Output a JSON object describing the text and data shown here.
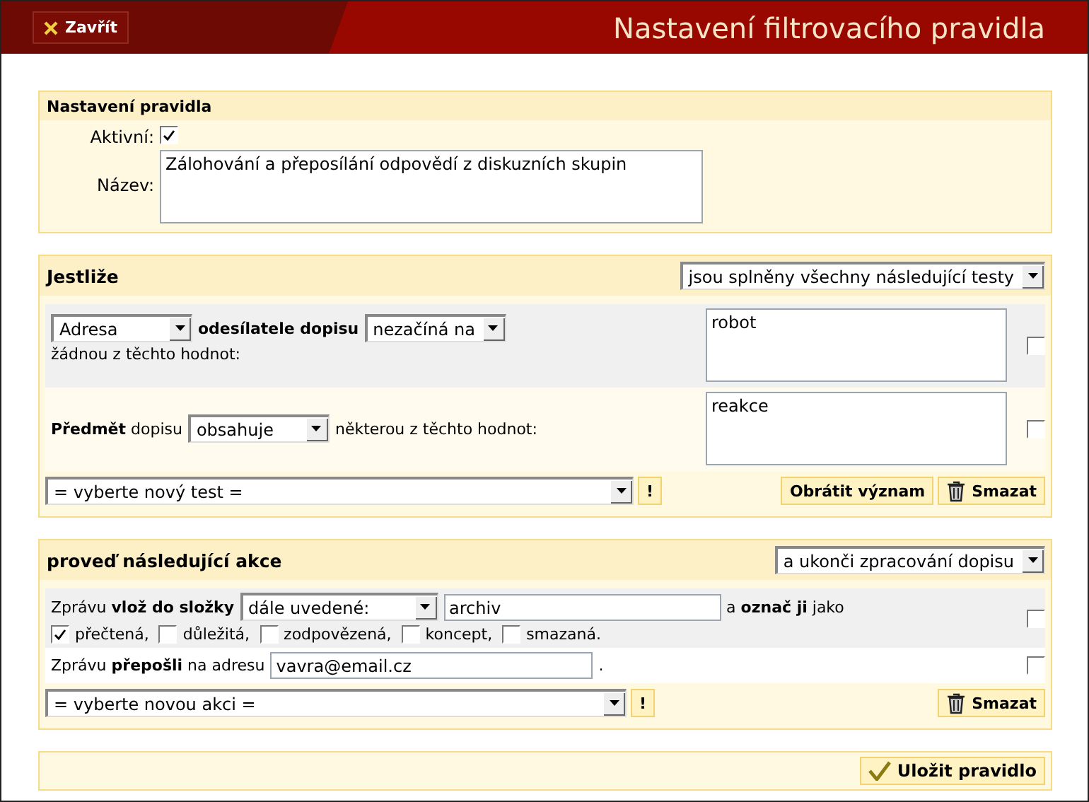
{
  "header": {
    "close_button": "Zavřít",
    "title": "Nastavení filtrovacího pravidla"
  },
  "rule_settings": {
    "title": "Nastavení pravidla",
    "active_label": "Aktivní:",
    "active_checked": true,
    "name_label": "Název:",
    "name_value": "Zálohování a přeposílání odpovědí z diskuzních skupin"
  },
  "conditions": {
    "title": "Jestliže",
    "mode": "jsou splněny všechny následující testy",
    "rows": [
      {
        "checked": false,
        "values": "robot",
        "parts": [
          {
            "kind": "select",
            "value": "Adresa"
          },
          {
            "kind": "text",
            "text": "**odesílatele dopisu**"
          },
          {
            "kind": "select",
            "value": "nezačíná na"
          },
          {
            "kind": "text",
            "text": "žádnou z těchto hodnot:"
          }
        ]
      },
      {
        "checked": false,
        "values": "reakce",
        "parts": [
          {
            "kind": "text",
            "text": "**Předmět** dopisu"
          },
          {
            "kind": "select",
            "value": "obsahuje"
          },
          {
            "kind": "text",
            "text": "některou z těchto hodnot:"
          }
        ]
      }
    ],
    "new_test": "= vyberte nový test =",
    "confirm_button": "!",
    "invert_button": "Obrátit význam",
    "delete_button": "Smazat"
  },
  "actions": {
    "title": "proveď následující akce",
    "mode": "a ukonči zpracování dopisu",
    "rows": [
      {
        "checked": false,
        "parts": [
          {
            "kind": "text",
            "text": "Zprávu **vlož do složky**"
          },
          {
            "kind": "select",
            "value": "dále uvedené:"
          },
          {
            "kind": "input",
            "value": "archiv"
          },
          {
            "kind": "text",
            "text": "a **označ ji** jako"
          }
        ],
        "flags": [
          {
            "label": "přečtená,",
            "checked": true
          },
          {
            "label": "důležitá,",
            "checked": false
          },
          {
            "label": "zodpovězená,",
            "checked": false
          },
          {
            "label": "koncept,",
            "checked": false
          },
          {
            "label": "smazaná.",
            "checked": false
          }
        ]
      },
      {
        "checked": false,
        "parts": [
          {
            "kind": "text",
            "text": "Zprávu **přepošli** na adresu"
          },
          {
            "kind": "input",
            "value": "vavra@email.cz"
          },
          {
            "kind": "text",
            "text": "."
          }
        ]
      }
    ],
    "new_action": "= vyberte novou akci =",
    "confirm_button": "!",
    "delete_button": "Smazat"
  },
  "footer": {
    "save_button": "Uložit pravidlo"
  }
}
